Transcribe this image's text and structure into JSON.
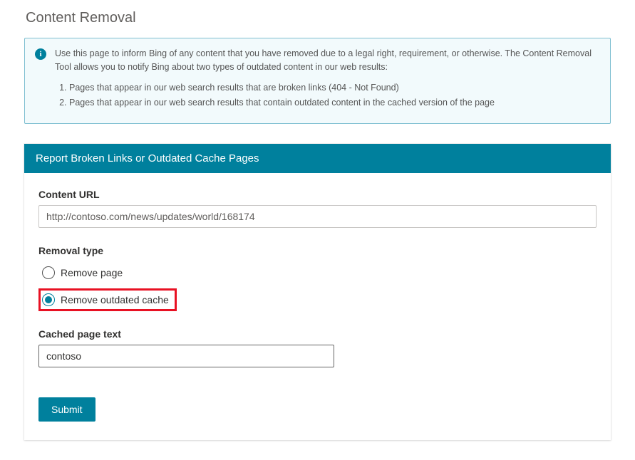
{
  "page": {
    "title": "Content Removal"
  },
  "info": {
    "intro": "Use this page to inform Bing of any content that you have removed due to a legal right, requirement, or otherwise. The Content Removal Tool allows you to notify Bing about two types of outdated content in our web results:",
    "items": [
      "Pages that appear in our web search results that are broken links (404 - Not Found)",
      "Pages that appear in our web search results that contain outdated content in the cached version of the page"
    ]
  },
  "form": {
    "header": "Report Broken Links or Outdated Cache Pages",
    "content_url": {
      "label": "Content URL",
      "value": "http://contoso.com/news/updates/world/168174"
    },
    "removal_type": {
      "label": "Removal type",
      "options": [
        {
          "label": "Remove page",
          "checked": false
        },
        {
          "label": "Remove outdated cache",
          "checked": true
        }
      ],
      "selected_index": 1
    },
    "cached_text": {
      "label": "Cached page text",
      "value": "contoso"
    },
    "submit_label": "Submit"
  },
  "colors": {
    "accent": "#00809d",
    "highlight": "#e81123"
  }
}
